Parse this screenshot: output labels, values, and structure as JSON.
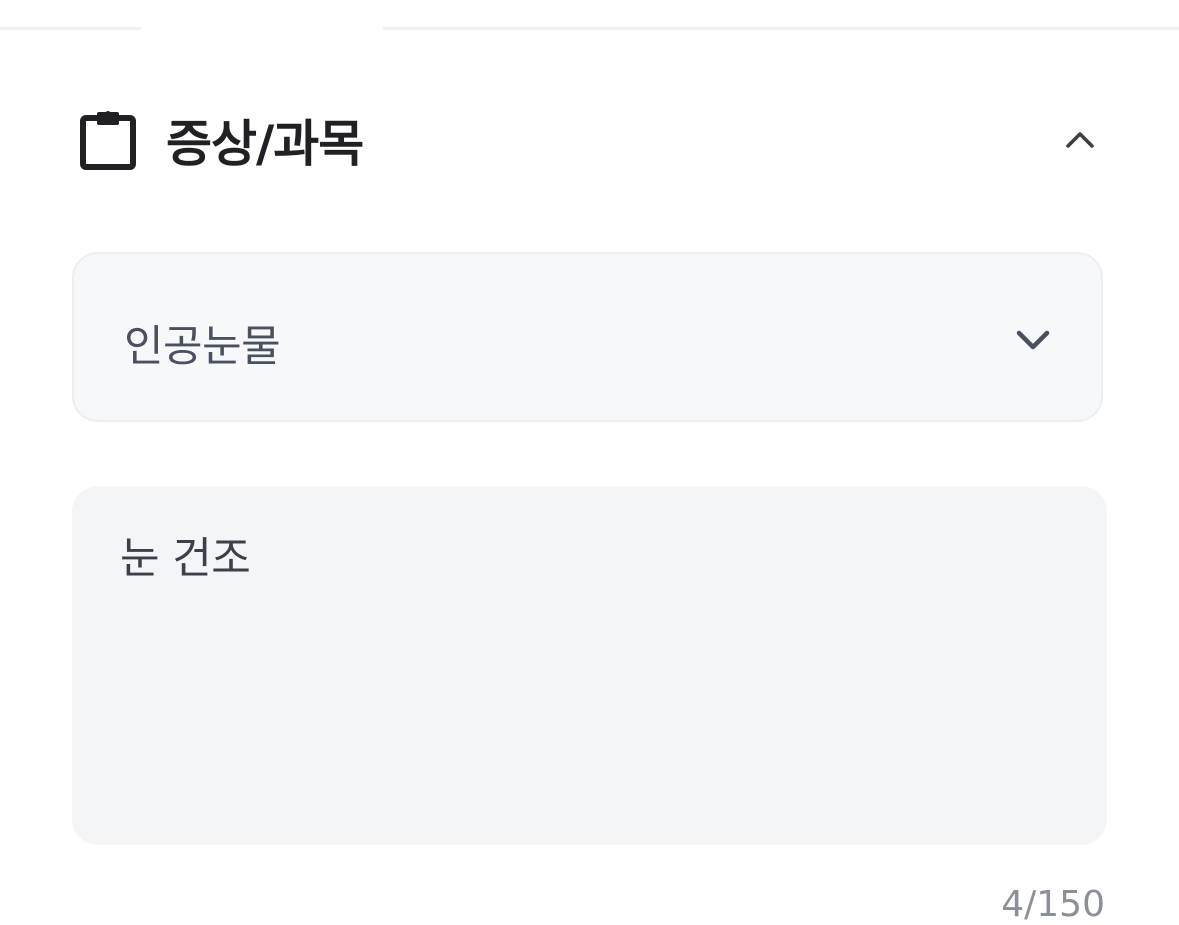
{
  "section": {
    "title": "증상/과목",
    "icon": "clipboard-icon",
    "collapse_icon": "chevron-up-icon"
  },
  "department_select": {
    "selected_value": "인공눈물",
    "icon": "chevron-down-icon"
  },
  "symptom_input": {
    "value": "눈 건조"
  },
  "char_counter": {
    "count": "4",
    "separator": "/",
    "max": "150"
  },
  "colors": {
    "title_text": "#1f2125",
    "select_bg": "#f7f8fa",
    "textarea_bg": "#f4f5f7",
    "counter_text": "#8b8f98"
  }
}
